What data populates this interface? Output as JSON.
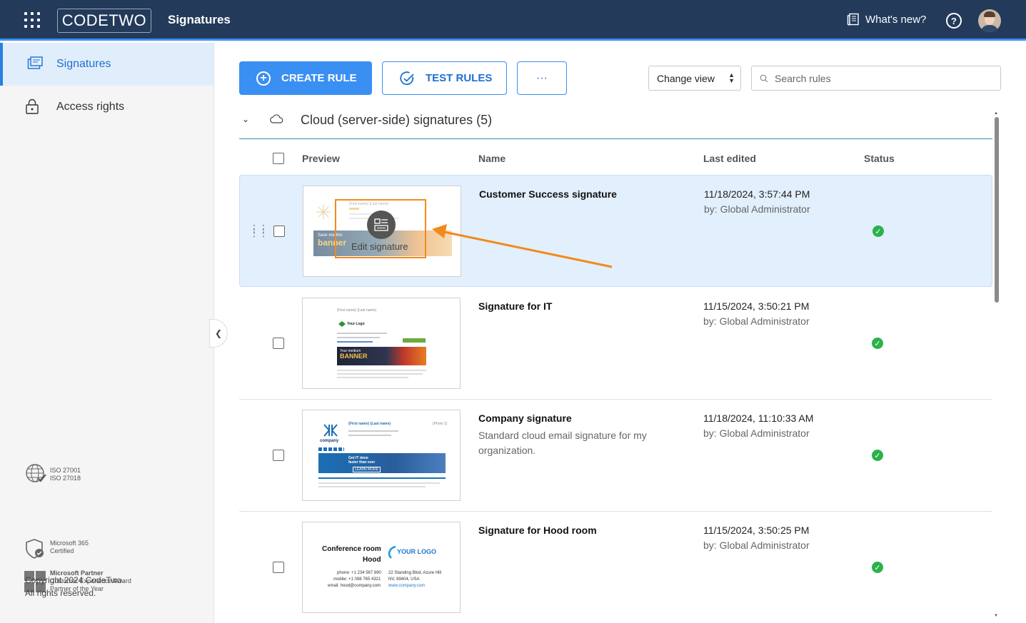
{
  "header": {
    "logo": "CODETWO",
    "app_title": "Signatures",
    "whats_new": "What's new?",
    "help": "?"
  },
  "sidebar": {
    "items": [
      {
        "label": "Signatures",
        "icon": "signatures-icon",
        "active": true
      },
      {
        "label": "Access rights",
        "icon": "lock-icon",
        "active": false
      }
    ],
    "certs": [
      {
        "line1": "ISO 27001",
        "line2": "ISO 27018",
        "line3": ""
      },
      {
        "line1": "Microsoft 365",
        "line2": "Certified",
        "line3": ""
      },
      {
        "line1": "Microsoft Partner",
        "line2": "Customer Experience Award",
        "line3": "Partner of the Year"
      }
    ],
    "copyright_line1": "Copyright 2024 CodeTwo.",
    "copyright_line2": "All rights reserved."
  },
  "toolbar": {
    "create_rule": "CREATE RULE",
    "test_rules": "TEST RULES",
    "more": "···",
    "change_view": "Change view",
    "search_placeholder": "Search rules"
  },
  "group": {
    "title": "Cloud (server-side) signatures (5)"
  },
  "table": {
    "headers": {
      "preview": "Preview",
      "name": "Name",
      "last_edited": "Last edited",
      "status": "Status"
    },
    "rows": [
      {
        "name": "Customer Success signature",
        "description": "",
        "date": "11/18/2024, 3:57:44 PM",
        "by": "by: Global Administrator",
        "status": "enabled"
      },
      {
        "name": "Signature for IT",
        "description": "",
        "date": "11/15/2024, 3:50:21 PM",
        "by": "by: Global Administrator",
        "status": "enabled"
      },
      {
        "name": "Company signature",
        "description": "Standard cloud email signature for my organization.",
        "date": "11/18/2024, 11:10:33 AM",
        "by": "by: Global Administrator",
        "status": "enabled"
      },
      {
        "name": "Signature for Hood room",
        "description": "",
        "date": "11/15/2024, 3:50:25 PM",
        "by": "by: Global Administrator",
        "status": "enabled"
      }
    ]
  },
  "thumbs": {
    "t1_name": "{First name} {Last name}",
    "t1_banner1": "Save me this",
    "t1_banner2": "banner",
    "t2_name": "{First name} {Last name}",
    "t2_logo": "Your Logo",
    "t2_banner1": "Your medium",
    "t2_banner2": "BANNER",
    "t3_name": "{First name} {Last name}",
    "t3_photo": "{Photo 1}",
    "t3_company": "company",
    "t3_banner1": "Got IT done",
    "t3_banner2": "faster than ever",
    "t3_learn": "LEARN MORE",
    "t4_title1": "Conference room",
    "t4_title2": "Hood",
    "t4_logo": "YOUR LOGO",
    "t4_phone": "phone: +1 234 567 890",
    "t4_mobile": "mobile: +1 098 765 4321",
    "t4_email": "email: hood@company.com",
    "t4_addr1": "22 Standing Blvd, Azure Hill",
    "t4_addr2": "NV, 89404, USA",
    "t4_web": "www.company.com"
  },
  "overlay": {
    "edit_label": "Edit signature"
  },
  "colors": {
    "topbar": "#233a5b",
    "accent": "#3a8ff2",
    "selected_row": "#e2effc",
    "status_ok": "#2bb24c",
    "annotation": "#f28a1b"
  }
}
